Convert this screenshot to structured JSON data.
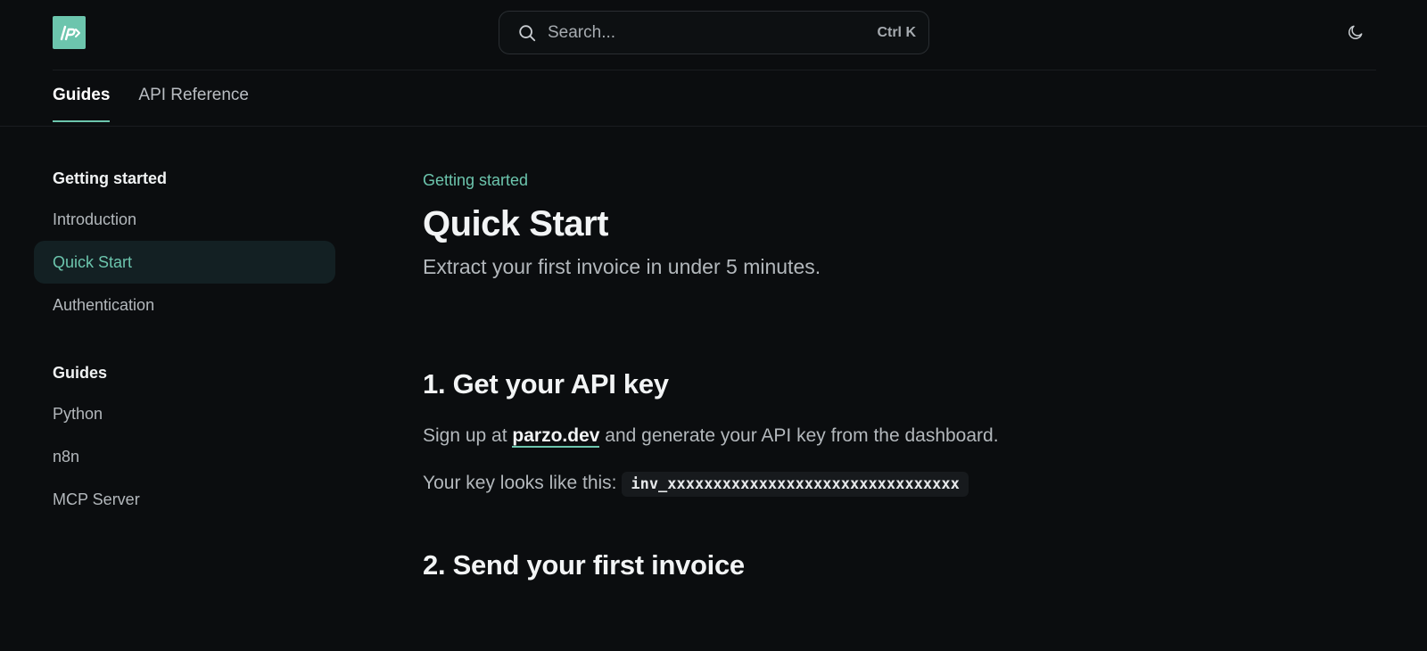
{
  "header": {
    "search": {
      "placeholder": "Search...",
      "shortcut": "Ctrl K"
    },
    "tabs": [
      {
        "label": "Guides",
        "active": true
      },
      {
        "label": "API Reference",
        "active": false
      }
    ]
  },
  "sidebar": {
    "sections": [
      {
        "title": "Getting started",
        "items": [
          {
            "label": "Introduction",
            "active": false
          },
          {
            "label": "Quick Start",
            "active": true
          },
          {
            "label": "Authentication",
            "active": false
          }
        ]
      },
      {
        "title": "Guides",
        "items": [
          {
            "label": "Python",
            "active": false
          },
          {
            "label": "n8n",
            "active": false
          },
          {
            "label": "MCP Server",
            "active": false
          }
        ]
      }
    ]
  },
  "content": {
    "eyebrow": "Getting started",
    "title": "Quick Start",
    "subtitle": "Extract your first invoice in under 5 minutes.",
    "step1": {
      "heading": "1. Get your API key",
      "para_prefix": "Sign up at ",
      "link": "parzo.dev",
      "para_suffix": " and generate your API key from the dashboard.",
      "key_prefix": "Your key looks like this:",
      "key_example": "inv_xxxxxxxxxxxxxxxxxxxxxxxxxxxxxxxx"
    },
    "step2": {
      "heading": "2. Send your first invoice"
    }
  },
  "colors": {
    "accent": "#6cc5ad",
    "background": "#0b0d0f",
    "active_nav_bg": "#132023"
  },
  "icons": {
    "logo": "parzo-logo",
    "search": "search-icon",
    "theme": "moon-icon"
  }
}
